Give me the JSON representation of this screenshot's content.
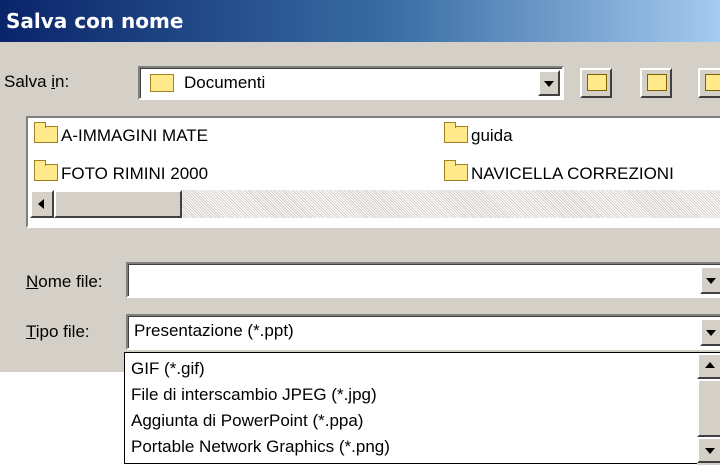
{
  "window": {
    "title": "Salva con nome"
  },
  "save_in": {
    "label_pre": "Salva ",
    "label_accel": "i",
    "label_post": "n:",
    "value": "Documenti",
    "icon": "open-folder-icon"
  },
  "toolbar": {
    "buttons": [
      {
        "icon": "up-one-level-icon"
      },
      {
        "icon": "new-folder-icon"
      },
      {
        "icon": "view-menu-icon"
      }
    ]
  },
  "files": [
    {
      "name": "A-IMMAGINI MATE",
      "icon": "folder-icon"
    },
    {
      "name": "guida",
      "icon": "folder-icon"
    },
    {
      "name": "FOTO RIMINI 2000",
      "icon": "folder-icon"
    },
    {
      "name": "NAVICELLA CORREZIONI",
      "icon": "folder-icon"
    }
  ],
  "file_name": {
    "label_accel": "N",
    "label_post": "ome file:",
    "value": ""
  },
  "file_type": {
    "label_accel": "T",
    "label_post": "ipo file:",
    "value": "Presentazione (*.ppt)",
    "options": [
      "GIF (*.gif)",
      "File di interscambio JPEG (*.jpg)",
      "Aggiunta di PowerPoint (*.ppa)",
      "Portable Network Graphics (*.png)"
    ]
  },
  "colors": {
    "titlebar_start": "#0a246a",
    "titlebar_end": "#a6caf0",
    "dialog_face": "#d4d0c8",
    "folder_yellow": "#ffe98a"
  }
}
